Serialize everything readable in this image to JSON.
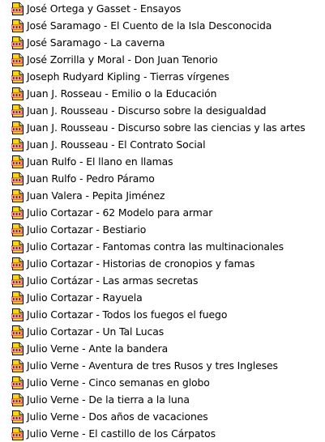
{
  "files": [
    {
      "name": "José Ortega y Gasset - Ensayos",
      "icon": "pdf-file-icon"
    },
    {
      "name": "José Saramago - El Cuento de la Isla Desconocida",
      "icon": "pdf-file-icon"
    },
    {
      "name": "José Saramago - La caverna",
      "icon": "pdf-file-icon"
    },
    {
      "name": "José Zorrilla y Moral - Don Juan Tenorio",
      "icon": "pdf-file-icon"
    },
    {
      "name": "Joseph Rudyard Kipling - Tierras vírgenes",
      "icon": "pdf-file-icon"
    },
    {
      "name": "Juan J. Rosseau - Emilio o la Educación",
      "icon": "pdf-file-icon"
    },
    {
      "name": "Juan J. Rousseau - Discurso sobre la desigualdad",
      "icon": "pdf-file-icon"
    },
    {
      "name": "Juan J. Rousseau - Discurso sobre las ciencias y las artes",
      "icon": "pdf-file-icon"
    },
    {
      "name": "Juan J. Rousseau - El Contrato Social",
      "icon": "pdf-file-icon"
    },
    {
      "name": "Juan Rulfo - El llano en llamas",
      "icon": "pdf-file-icon"
    },
    {
      "name": "Juan Rulfo - Pedro Páramo",
      "icon": "pdf-file-icon"
    },
    {
      "name": "Juan Valera - Pepita Jiménez",
      "icon": "pdf-file-icon"
    },
    {
      "name": "Julio Cortazar - 62 Modelo para armar",
      "icon": "pdf-file-icon"
    },
    {
      "name": "Julio Cortazar - Bestiario",
      "icon": "pdf-file-icon"
    },
    {
      "name": "Julio Cortazar - Fantomas contra las multinacionales",
      "icon": "pdf-file-icon"
    },
    {
      "name": "Julio Cortazar - Historias de cronopios y famas",
      "icon": "pdf-file-icon"
    },
    {
      "name": "Julio Cortázar - Las armas secretas",
      "icon": "pdf-file-icon"
    },
    {
      "name": "Julio Cortazar - Rayuela",
      "icon": "pdf-file-icon"
    },
    {
      "name": "Julio Cortazar - Todos los fuegos el fuego",
      "icon": "pdf-file-icon"
    },
    {
      "name": "Julio Cortazar - Un Tal Lucas",
      "icon": "pdf-file-icon"
    },
    {
      "name": "Julio Verne - Ante la bandera",
      "icon": "pdf-file-icon"
    },
    {
      "name": "Julio Verne - Aventura de tres Rusos y tres Ingleses",
      "icon": "pdf-file-icon"
    },
    {
      "name": "Julio Verne - Cinco semanas en globo",
      "icon": "pdf-file-icon"
    },
    {
      "name": "Julio Verne - De la tierra a la luna",
      "icon": "pdf-file-icon"
    },
    {
      "name": "Julio Verne - Dos años de vacaciones",
      "icon": "pdf-file-icon"
    },
    {
      "name": "Julio Verne - El castillo de los Cárpatos",
      "icon": "pdf-file-icon"
    }
  ],
  "colors": {
    "icon_fill": "#ffd800",
    "icon_border": "#000000",
    "icon_text": "#c00000",
    "text": "#000000",
    "background": "#ffffff"
  }
}
